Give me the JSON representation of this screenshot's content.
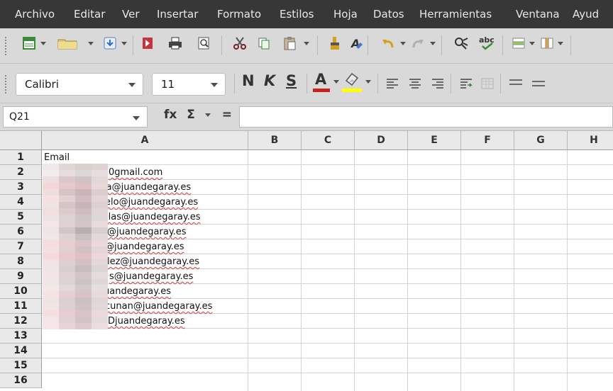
{
  "menu": [
    "Archivo",
    "Editar",
    "Ver",
    "Insertar",
    "Formato",
    "Estilos",
    "Hoja",
    "Datos",
    "Herramientas",
    "Ventana",
    "Ayud"
  ],
  "toolbar1": {
    "icons": [
      "new-spreadsheet",
      "open",
      "save",
      "export-pdf",
      "print",
      "print-preview",
      "cut",
      "copy",
      "paste",
      "clone-formatting",
      "clear-formatting",
      "undo",
      "redo",
      "find-replace",
      "spelling",
      "row",
      "column"
    ]
  },
  "toolbar2": {
    "font_name": "Calibri",
    "font_size": "11",
    "bold": "N",
    "italic": "K",
    "underline": "S",
    "font_color_letter": "A",
    "font_color": "#c9211e",
    "highlight_color": "#ffff00"
  },
  "formula_bar": {
    "name_box": "Q21",
    "fx": "fx",
    "sigma": "Σ",
    "equals": "="
  },
  "sheet": {
    "columns": [
      "A",
      "B",
      "C",
      "D",
      "E",
      "F",
      "G",
      "H"
    ],
    "rows": [
      "1",
      "2",
      "3",
      "4",
      "5",
      "6",
      "7",
      "8",
      "9",
      "10",
      "11",
      "12",
      "13",
      "14",
      "15",
      "16"
    ],
    "cells": [
      "Email",
      "0gmail.com",
      "ia@juandegaray.es",
      "elo@juandegaray.es",
      "llas@juandegaray.es",
      "@juandegaray.es",
      "@juandegaray.es",
      "lez@juandegaray.es",
      "s@juandegaray.es",
      "uandegaray.es",
      "cunan@juandegaray.es",
      "Djuandegaray.es"
    ]
  }
}
